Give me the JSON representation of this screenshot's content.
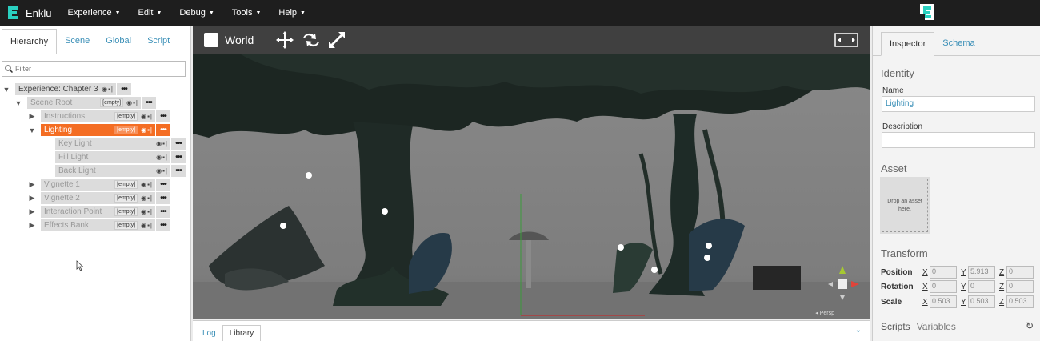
{
  "app": {
    "name": "Enklu"
  },
  "menu": [
    {
      "label": "Experience"
    },
    {
      "label": "Edit"
    },
    {
      "label": "Debug"
    },
    {
      "label": "Tools"
    },
    {
      "label": "Help"
    }
  ],
  "left_tabs": [
    {
      "label": "Hierarchy",
      "active": true
    },
    {
      "label": "Scene"
    },
    {
      "label": "Global"
    },
    {
      "label": "Script"
    }
  ],
  "filter": {
    "placeholder": "Filter"
  },
  "hierarchy": {
    "experience": "Experience: Chapter 3",
    "scene_root": "Scene Root",
    "empty_tag": "[empty]",
    "items": [
      {
        "label": "Instructions"
      },
      {
        "label": "Lighting"
      },
      {
        "label": "Key Light"
      },
      {
        "label": "Fill Light"
      },
      {
        "label": "Back Light"
      },
      {
        "label": "Vignette 1"
      },
      {
        "label": "Vignette 2"
      },
      {
        "label": "Interaction Point"
      },
      {
        "label": "Effects Bank"
      }
    ]
  },
  "viewport": {
    "world_label": "World",
    "persp_label": "Persp"
  },
  "bottom_tabs": [
    {
      "label": "Log"
    },
    {
      "label": "Library",
      "active": true
    }
  ],
  "inspector": {
    "tabs": [
      {
        "label": "Inspector",
        "active": true
      },
      {
        "label": "Schema"
      }
    ],
    "identity_title": "Identity",
    "name_label": "Name",
    "name_value": "Lighting",
    "description_label": "Description",
    "description_value": "",
    "asset_title": "Asset",
    "drop_text": "Drop an asset here.",
    "transform_title": "Transform",
    "position_label": "Position",
    "rotation_label": "Rotation",
    "scale_label": "Scale",
    "axis_x": "X",
    "axis_y": "Y",
    "axis_z": "Z",
    "position": {
      "x": "0",
      "y": "5.913",
      "z": "0"
    },
    "rotation": {
      "x": "0",
      "y": "0",
      "z": "0"
    },
    "scale": {
      "x": "0.503",
      "y": "0.503",
      "z": "0.503"
    },
    "scripts_label": "Scripts",
    "variables_label": "Variables"
  },
  "colors": {
    "accent": "#f46d23",
    "link": "#3a8fb7",
    "menubar": "#1e1e1e"
  }
}
